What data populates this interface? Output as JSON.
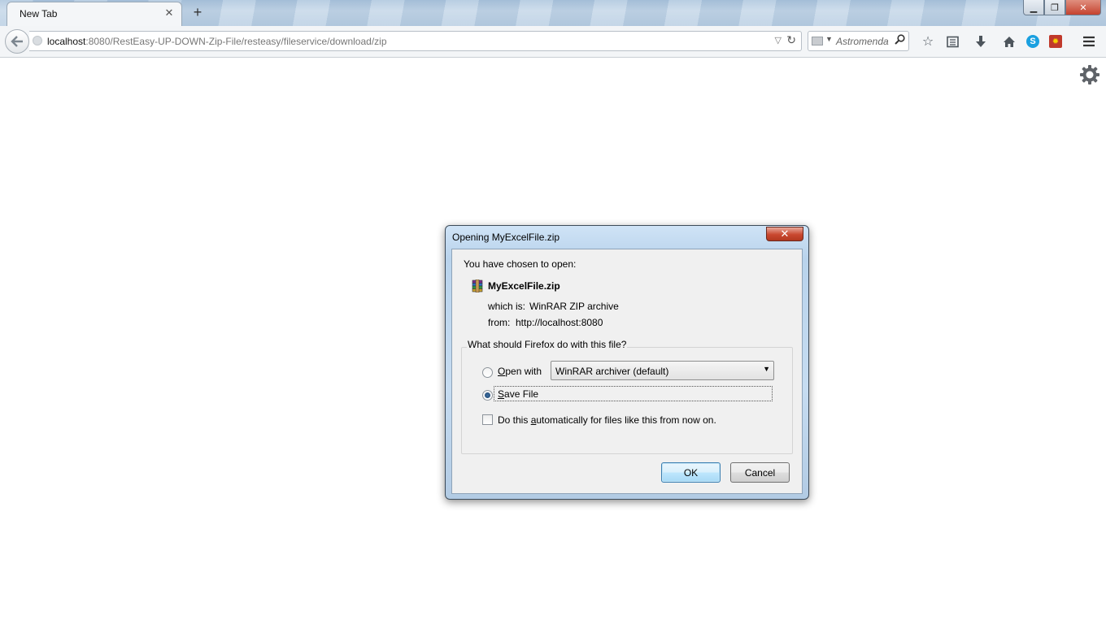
{
  "browser": {
    "tab": {
      "title": "New Tab",
      "close_glyph": "✕"
    },
    "new_tab_glyph": "+",
    "window_controls": {
      "minimize": "▁",
      "restore": "❐",
      "close": "✕"
    },
    "urlbar": {
      "host": "localhost",
      "path": ":8080/RestEasy-UP-DOWN-Zip-File/resteasy/fileservice/download/zip"
    },
    "search": {
      "placeholder": "Astromenda"
    },
    "toolbar_icons": [
      "star-icon",
      "reading-list-icon",
      "download-icon",
      "home-icon",
      "skype-icon",
      "addon-icon",
      "menu-icon"
    ]
  },
  "dialog": {
    "title": "Opening MyExcelFile.zip",
    "intro": "You have chosen to open:",
    "file_name": "MyExcelFile.zip",
    "which_is_label": "which is:",
    "which_is_value": "WinRAR ZIP archive",
    "from_label": "from:",
    "from_value": "http://localhost:8080",
    "question": "What should Firefox do with this file?",
    "open_with_label_pre": "",
    "open_with_label_ul": "O",
    "open_with_label_post": "pen with",
    "open_with_value": "WinRAR archiver (default)",
    "open_with_checked": false,
    "save_file_label_ul": "S",
    "save_file_label_post": "ave File",
    "save_file_checked": true,
    "auto_label_pre": "Do this ",
    "auto_label_ul": "a",
    "auto_label_post": "utomatically for files like this from now on.",
    "auto_checked": false,
    "ok_label": "OK",
    "cancel_label": "Cancel"
  }
}
